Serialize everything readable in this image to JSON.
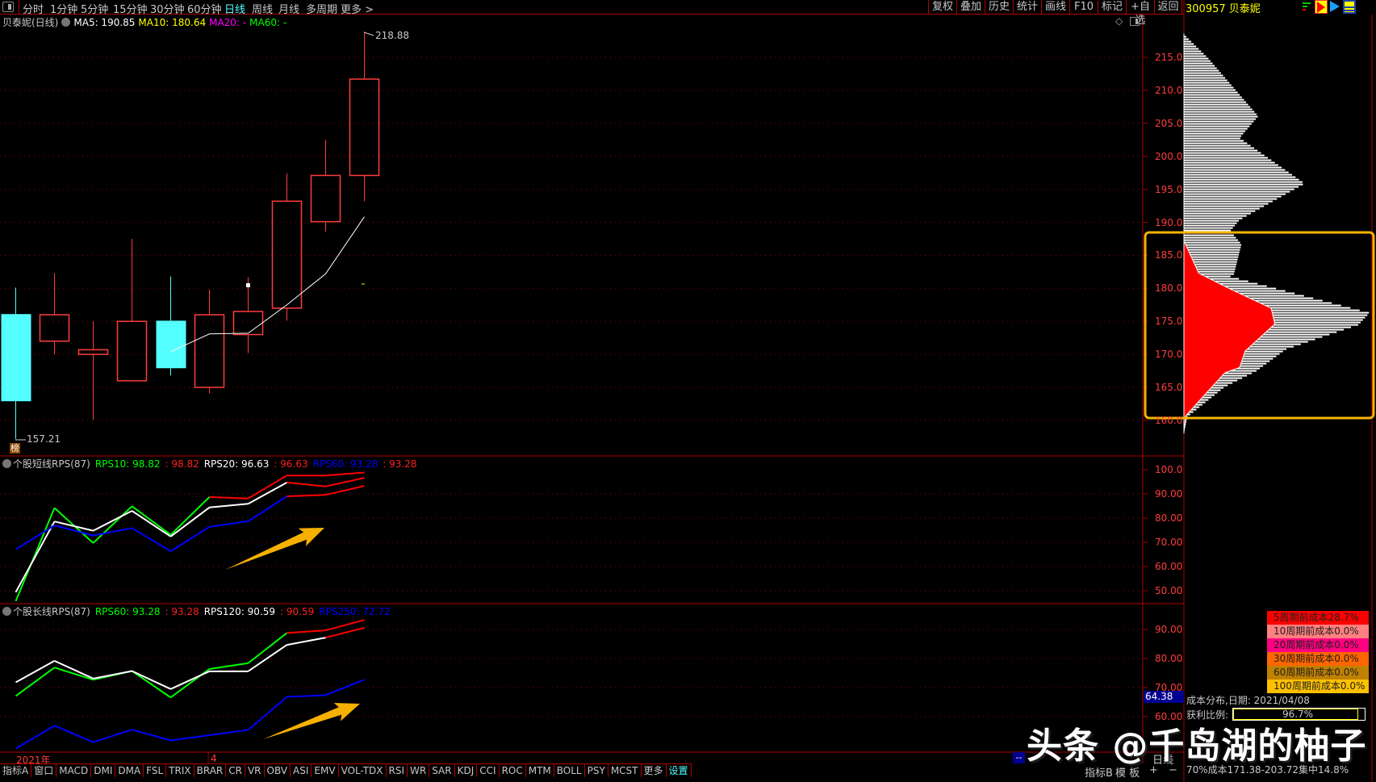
{
  "toolbar": {
    "tabs": [
      "分时",
      "1分钟",
      "5分钟",
      "15分钟",
      "30分钟",
      "60分钟",
      "日线",
      "周线",
      "月线",
      "多周期",
      "更多 >"
    ],
    "active_tab": "日线",
    "right_buttons": [
      "复权",
      "叠加",
      "历史",
      "统计",
      "画线",
      "F10",
      "标记",
      "+自选",
      "返回"
    ],
    "stock_code_name": "300957 贝泰妮"
  },
  "legend": {
    "title": "贝泰妮(日线)",
    "ma5": "MA5: 190.85",
    "ma10": "MA10: 180.64",
    "ma20": "MA20: -",
    "ma60": "MA60: -"
  },
  "colors": {
    "up": "#ff3c3c",
    "down": "#54ffff",
    "ma5": "#ffffff",
    "grid": "#8a0000",
    "axis": "#b00000",
    "arrow": "#f5b000",
    "highlight_box": "#f5b400"
  },
  "price_labels": {
    "high": "218.88",
    "low": "157.21",
    "badge": "榜"
  },
  "price_axis": [
    "215.0",
    "210.0",
    "205.0",
    "200.0",
    "195.0",
    "190.0",
    "185.0",
    "180.0",
    "175.0",
    "170.0",
    "165.0",
    "160.0"
  ],
  "panel_short": {
    "title": "个股短线RPS(87)",
    "rps10": "RPS10: 98.82",
    "rps10_r": ": 98.82",
    "rps20": "RPS20: 96.63",
    "rps20_r": ": 96.63",
    "rps60": "RPS60: 93.28",
    "rps60_r": ": 93.28",
    "axis": [
      "100.0",
      "90.00",
      "80.00",
      "70.00",
      "60.00",
      "50.00"
    ]
  },
  "panel_long": {
    "title": "个股长线RPS(87)",
    "rps60": "RPS60: 93.28",
    "rps60_r": ": 93.28",
    "rps120": "RPS120: 90.59",
    "rps120_r": ": 90.59",
    "rps250": "RPS250: 72.72",
    "axis": [
      "90.00",
      "80.00",
      "70.00",
      "60.00"
    ],
    "cursor_value": "64.38"
  },
  "time_axis": {
    "year": "2021年",
    "month": "4",
    "cursor": "--"
  },
  "bottom_tabs": [
    "指标A",
    "窗口",
    "MACD",
    "DMI",
    "DMA",
    "FSL",
    "TRIX",
    "BRAR",
    "CR",
    "VR",
    "OBV",
    "ASI",
    "EMV",
    "VOL-TDX",
    "RSI",
    "WR",
    "SAR",
    "KDJ",
    "CCI",
    "ROC",
    "MTM",
    "BOLL",
    "PSY",
    "MCST",
    "更多",
    "设置"
  ],
  "bottom_right": {
    "period": "日线",
    "indicator_b": "指标B",
    "template": "模 板",
    "plus": "+",
    "minus": "−"
  },
  "cost_panel": {
    "legend": [
      {
        "label": "5周期前成本28.7%",
        "color": "#ff0000"
      },
      {
        "label": "10周期前成本0.0%",
        "color": "#ff8080"
      },
      {
        "label": "20周期前成本0.0%",
        "color": "#ff0080"
      },
      {
        "label": "30周期前成本0.0%",
        "color": "#ff6600"
      },
      {
        "label": "60周期前成本0.0%",
        "color": "#c08000"
      },
      {
        "label": "100周期前成本0.0%",
        "color": "#ffc000"
      }
    ],
    "date_line": "成本分布,日期: 2021/04/08",
    "profit_label": "获利比例:",
    "profit_value": "96.7%",
    "profit_ratio": 0.967,
    "cost70": "70%成本171.38-203.72集中14.8%"
  },
  "watermark": "头条 @千岛湖的柚子",
  "chart_data": [
    {
      "type": "candlestick",
      "title": "贝泰妮(日线)",
      "ylim": [
        157,
        220
      ],
      "open": [
        176.1,
        172.0,
        170.0,
        166.0,
        175.1,
        165.0,
        173.0,
        177.0,
        190.1,
        197.1
      ],
      "close": [
        162.9,
        176.0,
        170.7,
        175.0,
        167.9,
        176.0,
        176.5,
        193.2,
        197.1,
        211.7
      ],
      "high": [
        180.1,
        182.3,
        175.0,
        187.5,
        181.8,
        179.8,
        181.7,
        197.4,
        202.5,
        218.88
      ],
      "low": [
        157.21,
        170.0,
        160.1,
        166.0,
        166.8,
        164.1,
        170.2,
        175.1,
        188.6,
        193.2
      ],
      "ma5": [
        null,
        null,
        null,
        null,
        170.4,
        173.1,
        173.2,
        177.5,
        182.2,
        190.85
      ]
    },
    {
      "type": "line",
      "title": "个股短线RPS(87)",
      "ylim": [
        50,
        100
      ],
      "highlight_threshold": 87,
      "series": [
        {
          "name": "RPS10",
          "color": "#00ff00",
          "values": [
            45.7,
            84.2,
            69.7,
            84.9,
            73.1,
            88.7,
            88.1,
            97.6,
            97.6,
            98.82
          ]
        },
        {
          "name": "RPS20",
          "color": "#ffffff",
          "values": [
            49.4,
            78.6,
            74.8,
            83.0,
            72.4,
            84.4,
            85.9,
            94.7,
            93.1,
            96.63
          ]
        },
        {
          "name": "RPS60",
          "color": "#0000ff",
          "values": [
            67.1,
            77.0,
            72.8,
            75.9,
            66.3,
            76.4,
            78.7,
            89.0,
            89.6,
            93.28
          ]
        }
      ]
    },
    {
      "type": "line",
      "title": "个股长线RPS(87)",
      "ylim": [
        50,
        95
      ],
      "highlight_threshold": 87,
      "series": [
        {
          "name": "RPS60",
          "color": "#00ff00",
          "values": [
            67.1,
            76.9,
            72.7,
            75.7,
            66.6,
            76.4,
            78.4,
            88.8,
            89.7,
            93.28
          ]
        },
        {
          "name": "RPS120",
          "color": "#ffffff",
          "values": [
            71.8,
            79.2,
            73.1,
            75.7,
            69.5,
            75.6,
            75.6,
            84.7,
            87.2,
            90.59
          ]
        },
        {
          "name": "RPS250",
          "color": "#0000ff",
          "values": [
            49.0,
            56.9,
            51.2,
            55.5,
            51.8,
            53.6,
            55.4,
            66.8,
            67.4,
            72.72
          ]
        }
      ]
    },
    {
      "type": "area",
      "title": "成本分布",
      "x_unit": "price",
      "y_unit": "relative density %",
      "total": [
        [
          218.6,
          0
        ],
        [
          215,
          13
        ],
        [
          206.2,
          40
        ],
        [
          202.9,
          30
        ],
        [
          196,
          65
        ],
        [
          190.5,
          30
        ],
        [
          188.8,
          25
        ],
        [
          186.8,
          31
        ],
        [
          182.3,
          27
        ],
        [
          181.9,
          25
        ],
        [
          176.4,
          100
        ],
        [
          174.6,
          94
        ],
        [
          170.9,
          55
        ],
        [
          167.6,
          39
        ],
        [
          165.2,
          22
        ],
        [
          160.7,
          2
        ],
        [
          158.2,
          0
        ]
      ],
      "profit": [
        [
          187.2,
          0
        ],
        [
          182.3,
          8
        ],
        [
          179.9,
          25
        ],
        [
          177,
          47
        ],
        [
          174.6,
          49
        ],
        [
          170.5,
          33
        ],
        [
          168,
          30
        ],
        [
          167.2,
          22
        ],
        [
          163.5,
          10
        ],
        [
          160.7,
          1
        ],
        [
          158.2,
          0
        ]
      ]
    }
  ]
}
